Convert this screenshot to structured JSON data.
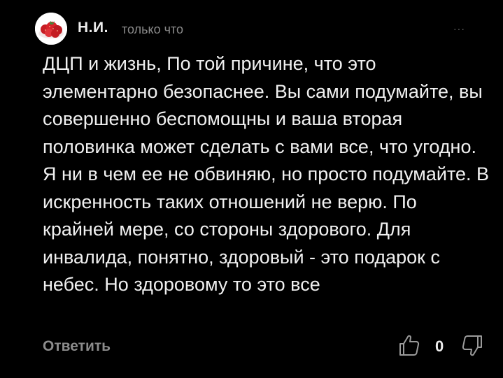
{
  "comment": {
    "author": "Н.И.",
    "time": "только что",
    "more_label": "···",
    "text": "ДЦП и жизнь, По той причине, что это элементарно безопаснее. Вы сами подумайте, вы совершенно беспомощны и ваша вторая половинка может сделать с вами все, что угодно. Я ни в чем ее не обвиняю, но просто подумайте. В искренность таких отношений не верю. По крайней мере, со стороны здорового. Для инвалида, понятно, здоровый - это подарок с небес. Но здоровому то это все",
    "reply_label": "Ответить",
    "score": "0"
  },
  "icons": {
    "avatar": "strawberries-avatar",
    "like": "thumbs-up-icon",
    "dislike": "thumbs-down-icon",
    "more": "more-dots-icon"
  },
  "colors": {
    "background": "#000000",
    "text": "#f0f0f0",
    "muted": "#8a8a8a",
    "avatar_fruit": "#d8232a"
  }
}
